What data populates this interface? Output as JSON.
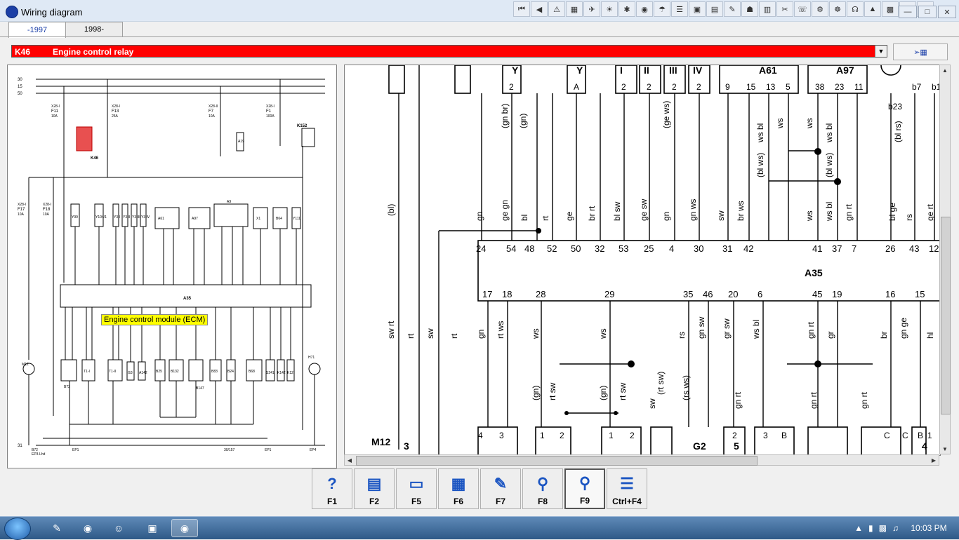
{
  "window": {
    "title": "Wiring diagram"
  },
  "toolbar": {
    "icons": [
      "first-page-icon",
      "prev-page-icon",
      "warning-icon",
      "tool-1-icon",
      "tool-2-icon",
      "tool-3-icon",
      "tool-4-icon",
      "tool-5-icon",
      "tool-6-icon",
      "tool-7-icon",
      "tool-8-icon",
      "tool-9-icon",
      "tool-10-icon",
      "tool-11-icon",
      "tool-12-icon",
      "tool-13-icon",
      "tool-14-icon",
      "tool-15-icon",
      "tool-16-icon",
      "tool-17-icon",
      "tool-18-icon",
      "tool-19-icon",
      "tool-20-icon",
      "tool-21-icon"
    ]
  },
  "tabs": [
    {
      "label": "-1997",
      "active": true
    },
    {
      "label": "1998-",
      "active": false
    }
  ],
  "component": {
    "code": "K46",
    "name": "Engine control relay",
    "color": "#ff0000"
  },
  "tooltip": {
    "text": "Engine control module (ECM)"
  },
  "left_diagram": {
    "rails": [
      "30",
      "15",
      "50",
      "31"
    ],
    "fuses": [
      {
        "top": "X28-I",
        "name": "F11",
        "rating": "10A"
      },
      {
        "top": "X28-I",
        "name": "F13",
        "rating": "25A"
      },
      {
        "top": "X28-II",
        "name": "F7",
        "rating": "10A"
      },
      {
        "top": "X28-I",
        "name": "F1",
        "rating": "100A"
      },
      {
        "top": "X28-I",
        "name": "F17",
        "rating": "10A"
      },
      {
        "top": "X28-I",
        "name": "F18",
        "rating": "10A"
      }
    ],
    "relays": [
      "K46",
      "K152"
    ],
    "modules": [
      "Y99",
      "Y104/1",
      "Y3 I",
      "Y3 II",
      "Y3 III",
      "Y3 IV",
      "A61",
      "A97",
      "A9",
      "X1",
      "B64",
      "Y111",
      "A19"
    ],
    "ecm": "A35",
    "bottom_components": [
      "M12",
      "B72",
      "T1-I",
      "T1-II",
      "G3",
      "A142",
      "B25",
      "B132",
      "B147",
      "B83",
      "B24",
      "B68",
      "S241",
      "K142",
      "K12",
      "H71"
    ],
    "footer": [
      "B72",
      "EP3-Lhd",
      "EP1",
      "30/157",
      "EP1",
      "EP4"
    ]
  },
  "right_diagram": {
    "top_labels": [
      "Y",
      "Y",
      "I",
      "II",
      "III",
      "IV",
      "A61",
      "A97"
    ],
    "top_pins": [
      "2",
      "A",
      "2",
      "2",
      "2",
      "2",
      "9",
      "15",
      "13",
      "5",
      "38",
      "23",
      "11",
      "b7",
      "b1",
      "b23"
    ],
    "wire_colors_top": [
      "(bl)",
      "(gn br)",
      "(gn)",
      "(ge ws)",
      "ws bl",
      "ws",
      "ws",
      "ws bl",
      "(bl ws)",
      "(bl ws)",
      "(bl rs)",
      "gn",
      "ge gn",
      "bl",
      "rt",
      "ge",
      "br rt",
      "bl sw",
      "ge sw",
      "gn",
      "gn ws",
      "sw",
      "br ws",
      "ws",
      "ws bl",
      "gn rt",
      "bl ge",
      "rs",
      "ge rt"
    ],
    "ecm_label": "A35",
    "ecm_top_pins": [
      "24",
      "54",
      "48",
      "52",
      "50",
      "32",
      "53",
      "25",
      "4",
      "30",
      "31",
      "42",
      "41",
      "37",
      "7",
      "26",
      "43",
      "12"
    ],
    "ecm_bottom_pins": [
      "17",
      "18",
      "28",
      "29",
      "35",
      "46",
      "20",
      "6",
      "45",
      "19",
      "16",
      "15"
    ],
    "wire_colors_bottom": [
      "sw rt",
      "rt",
      "sw",
      "rt",
      "gn",
      "rt ws",
      "ws",
      "ws",
      "rs",
      "gn sw",
      "gr sw",
      "ws bl",
      "gn rt",
      "gr",
      "br",
      "gn ge",
      "hl",
      "(gn)",
      "rt sw",
      "(gn)",
      "rt sw",
      "sw",
      "(rt sw)",
      "(rs ws)",
      "gn rt",
      "gn rt",
      "gn rt"
    ],
    "bottom_pins": [
      "4",
      "3",
      "1",
      "2",
      "1",
      "2",
      "2",
      "3",
      "B",
      "C",
      "C",
      "B",
      "1"
    ],
    "bottom_labels": [
      "M12",
      "3",
      "G2",
      "5",
      "4"
    ]
  },
  "fkeys": [
    {
      "label": "F1",
      "icon": "help-icon"
    },
    {
      "label": "F2",
      "icon": "print-icon"
    },
    {
      "label": "F5",
      "icon": "printer-icon"
    },
    {
      "label": "F6",
      "icon": "connector-icon"
    },
    {
      "label": "F7",
      "icon": "pen-icon"
    },
    {
      "label": "F8",
      "icon": "zoom-component-icon"
    },
    {
      "label": "F9",
      "icon": "magnify-icon",
      "active": true
    },
    {
      "label": "Ctrl+F4",
      "icon": "list-icon"
    }
  ],
  "taskbar": {
    "clock": "10:03 PM"
  }
}
